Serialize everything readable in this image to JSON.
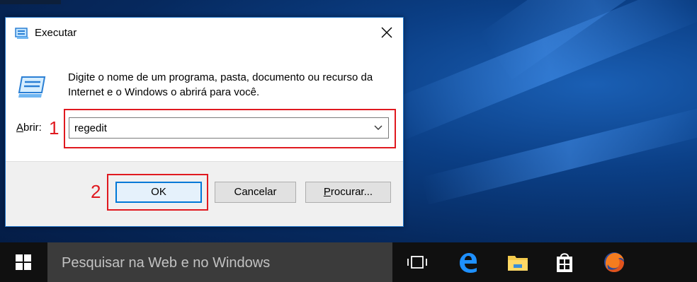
{
  "dialog": {
    "title": "Executar",
    "description": "Digite o nome de um programa, pasta, documento ou recurso da Internet e o Windows o abrirá para você.",
    "open_label_accel": "A",
    "open_label_rest": "brir:",
    "input_value": "regedit",
    "buttons": {
      "ok": "OK",
      "cancel": "Cancelar",
      "browse_accel": "P",
      "browse_rest": "rocurar..."
    }
  },
  "annotations": {
    "step1": "1",
    "step2": "2",
    "highlight_color": "#e0191f"
  },
  "taskbar": {
    "search_placeholder": "Pesquisar na Web e no Windows",
    "icons": [
      "windows-start-icon",
      "task-view-icon",
      "edge-icon",
      "file-explorer-icon",
      "store-icon",
      "firefox-icon"
    ]
  },
  "colors": {
    "accent": "#0078d7",
    "taskbar": "#101010",
    "search_box": "#3b3b3b"
  }
}
